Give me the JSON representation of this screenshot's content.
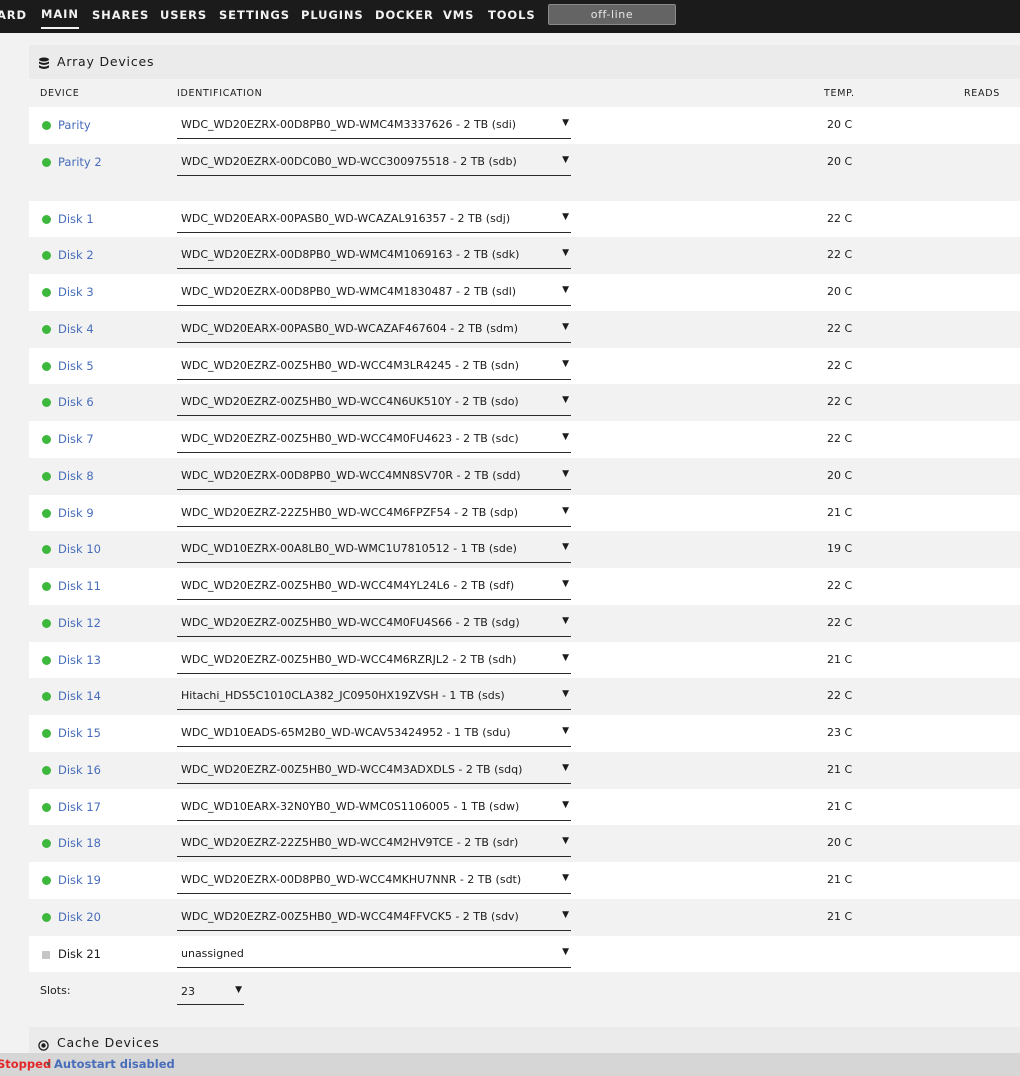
{
  "nav": {
    "items": [
      "ARD",
      "MAIN",
      "SHARES",
      "USERS",
      "SETTINGS",
      "PLUGINS",
      "DOCKER",
      "VMS",
      "TOOLS"
    ],
    "active": "MAIN",
    "status": "off-line"
  },
  "panel": {
    "title": "Array Devices",
    "icon": "database-icon",
    "headers": {
      "device": "DEVICE",
      "identification": "IDENTIFICATION",
      "temp": "TEMP.",
      "reads": "READS"
    }
  },
  "devices": [
    {
      "name": "Parity",
      "ident": "WDC_WD20EZRX-00D8PB0_WD-WMC4M3337626 - 2 TB (sdi)",
      "temp": "20 C",
      "status": "green"
    },
    {
      "name": "Parity 2",
      "ident": "WDC_WD20EZRX-00DC0B0_WD-WCC300975518 - 2 TB (sdb)",
      "temp": "20 C",
      "status": "green"
    },
    {
      "name": "Disk 1",
      "ident": "WDC_WD20EARX-00PASB0_WD-WCAZAL916357 - 2 TB (sdj)",
      "temp": "22 C",
      "status": "green"
    },
    {
      "name": "Disk 2",
      "ident": "WDC_WD20EZRX-00D8PB0_WD-WMC4M1069163 - 2 TB (sdk)",
      "temp": "22 C",
      "status": "green"
    },
    {
      "name": "Disk 3",
      "ident": "WDC_WD20EZRX-00D8PB0_WD-WMC4M1830487 - 2 TB (sdl)",
      "temp": "20 C",
      "status": "green"
    },
    {
      "name": "Disk 4",
      "ident": "WDC_WD20EARX-00PASB0_WD-WCAZAF467604 - 2 TB (sdm)",
      "temp": "22 C",
      "status": "green"
    },
    {
      "name": "Disk 5",
      "ident": "WDC_WD20EZRZ-00Z5HB0_WD-WCC4M3LR4245 - 2 TB (sdn)",
      "temp": "22 C",
      "status": "green"
    },
    {
      "name": "Disk 6",
      "ident": "WDC_WD20EZRZ-00Z5HB0_WD-WCC4N6UK510Y - 2 TB (sdo)",
      "temp": "22 C",
      "status": "green"
    },
    {
      "name": "Disk 7",
      "ident": "WDC_WD20EZRZ-00Z5HB0_WD-WCC4M0FU4623 - 2 TB (sdc)",
      "temp": "22 C",
      "status": "green"
    },
    {
      "name": "Disk 8",
      "ident": "WDC_WD20EZRX-00D8PB0_WD-WCC4MN8SV70R - 2 TB (sdd)",
      "temp": "20 C",
      "status": "green"
    },
    {
      "name": "Disk 9",
      "ident": "WDC_WD20EZRZ-22Z5HB0_WD-WCC4M6FPZF54 - 2 TB (sdp)",
      "temp": "21 C",
      "status": "green"
    },
    {
      "name": "Disk 10",
      "ident": "WDC_WD10EZRX-00A8LB0_WD-WMC1U7810512 - 1 TB (sde)",
      "temp": "19 C",
      "status": "green"
    },
    {
      "name": "Disk 11",
      "ident": "WDC_WD20EZRZ-00Z5HB0_WD-WCC4M4YL24L6 - 2 TB (sdf)",
      "temp": "22 C",
      "status": "green"
    },
    {
      "name": "Disk 12",
      "ident": "WDC_WD20EZRZ-00Z5HB0_WD-WCC4M0FU4S66 - 2 TB (sdg)",
      "temp": "22 C",
      "status": "green"
    },
    {
      "name": "Disk 13",
      "ident": "WDC_WD20EZRZ-00Z5HB0_WD-WCC4M6RZRJL2 - 2 TB (sdh)",
      "temp": "21 C",
      "status": "green"
    },
    {
      "name": "Disk 14",
      "ident": "Hitachi_HDS5C1010CLA382_JC0950HX19ZVSH - 1 TB (sds)",
      "temp": "22 C",
      "status": "green"
    },
    {
      "name": "Disk 15",
      "ident": "WDC_WD10EADS-65M2B0_WD-WCAV53424952 - 1 TB (sdu)",
      "temp": "23 C",
      "status": "green"
    },
    {
      "name": "Disk 16",
      "ident": "WDC_WD20EZRZ-00Z5HB0_WD-WCC4M3ADXDLS - 2 TB (sdq)",
      "temp": "21 C",
      "status": "green"
    },
    {
      "name": "Disk 17",
      "ident": "WDC_WD10EARX-32N0YB0_WD-WMC0S1106005 - 1 TB (sdw)",
      "temp": "21 C",
      "status": "green"
    },
    {
      "name": "Disk 18",
      "ident": "WDC_WD20EZRZ-22Z5HB0_WD-WCC4M2HV9TCE - 2 TB (sdr)",
      "temp": "20 C",
      "status": "green"
    },
    {
      "name": "Disk 19",
      "ident": "WDC_WD20EZRX-00D8PB0_WD-WCC4MKHU7NNR - 2 TB (sdt)",
      "temp": "21 C",
      "status": "green"
    },
    {
      "name": "Disk 20",
      "ident": "WDC_WD20EZRZ-00Z5HB0_WD-WCC4M4FFVCK5 - 2 TB (sdv)",
      "temp": "21 C",
      "status": "green"
    },
    {
      "name": "Disk 21",
      "ident": "unassigned",
      "temp": "",
      "status": "grey"
    }
  ],
  "slots": {
    "label": "Slots:",
    "value": "23"
  },
  "caret": "▼",
  "cache": {
    "title": "Cache Devices",
    "icon": "target-icon"
  },
  "footer": {
    "state": "Stopped",
    "separator": "•",
    "autostart": "Autostart disabled"
  },
  "colors": {
    "link": "#486dba",
    "green": "#3db83d",
    "grey": "#c5c5c5",
    "stopped": "#e22828"
  }
}
